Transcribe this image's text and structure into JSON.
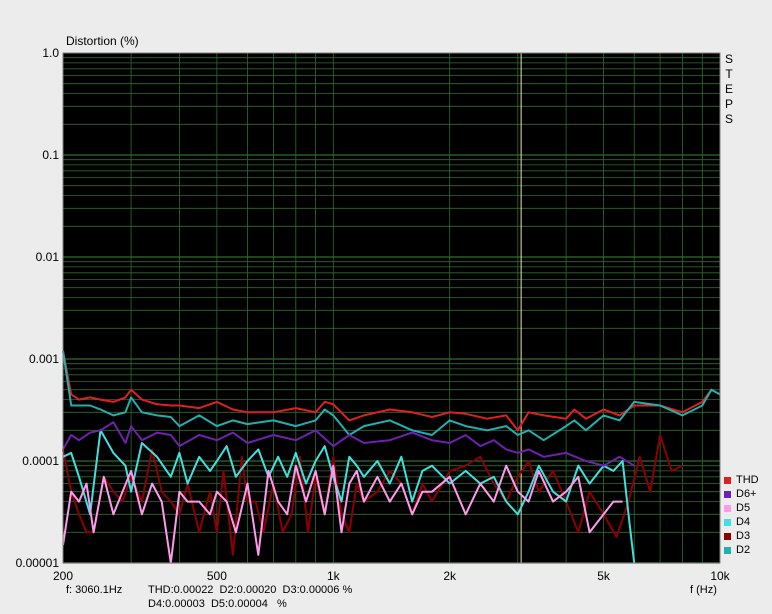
{
  "chart_data": {
    "type": "line",
    "title": "",
    "ylabel": "Distortion (%)",
    "xlabel": "f (Hz)",
    "xscale": "log",
    "yscale": "log",
    "xlim": [
      200,
      10000
    ],
    "ylim": [
      1e-05,
      1.0
    ],
    "grid": true,
    "background": "#000000",
    "grid_color": "#2f6b2f",
    "cursor_color": "#e8e8a0",
    "cursor_x": 3060.1,
    "side_label": [
      "S",
      "T",
      "E",
      "P",
      "S"
    ],
    "yticks": [
      {
        "value": 1.0,
        "label": "1.0"
      },
      {
        "value": 0.1,
        "label": "0.1"
      },
      {
        "value": 0.01,
        "label": "0.01"
      },
      {
        "value": 0.001,
        "label": "0.001"
      },
      {
        "value": 0.0001,
        "label": "0.0001"
      },
      {
        "value": 1e-05,
        "label": "0.00001"
      }
    ],
    "xticks": [
      {
        "value": 200,
        "label": "200"
      },
      {
        "value": 500,
        "label": "500"
      },
      {
        "value": 1000,
        "label": "1k"
      },
      {
        "value": 2000,
        "label": "2k"
      },
      {
        "value": 5000,
        "label": "5k"
      },
      {
        "value": 10000,
        "label": "10k"
      }
    ],
    "series": [
      {
        "name": "THD",
        "color": "#e02020",
        "x": [
          200,
          210,
          220,
          235,
          250,
          270,
          290,
          300,
          320,
          350,
          380,
          400,
          450,
          500,
          550,
          600,
          700,
          800,
          900,
          950,
          1000,
          1100,
          1200,
          1400,
          1600,
          1800,
          2000,
          2200,
          2500,
          2800,
          3000,
          3200,
          3500,
          4000,
          4200,
          4500,
          5000,
          5500,
          6000,
          7000,
          8000,
          9000,
          9500,
          10000
        ],
        "y": [
          0.0012,
          0.00045,
          0.0004,
          0.00042,
          0.0004,
          0.00038,
          0.00042,
          0.0005,
          0.0004,
          0.00036,
          0.00035,
          0.00035,
          0.00033,
          0.00038,
          0.00032,
          0.0003,
          0.0003,
          0.00033,
          0.0003,
          0.00038,
          0.00036,
          0.00025,
          0.00028,
          0.00032,
          0.0003,
          0.00027,
          0.0003,
          0.00029,
          0.00026,
          0.00028,
          0.0002,
          0.0003,
          0.00028,
          0.00026,
          0.00032,
          0.00026,
          0.00032,
          0.00028,
          0.00035,
          0.00035,
          0.0003,
          0.00038,
          0.0005,
          0.00045
        ]
      },
      {
        "name": "D2",
        "color": "#20b0b0",
        "x": [
          200,
          210,
          220,
          235,
          250,
          270,
          290,
          300,
          320,
          350,
          380,
          400,
          450,
          500,
          550,
          600,
          700,
          800,
          900,
          950,
          1000,
          1100,
          1200,
          1400,
          1600,
          1800,
          2000,
          2200,
          2500,
          2800,
          3000,
          3200,
          3500,
          4000,
          4200,
          4500,
          5000,
          5500,
          6000,
          7000,
          8000,
          9000,
          9500,
          10000
        ],
        "y": [
          0.0012,
          0.00035,
          0.00035,
          0.00035,
          0.00032,
          0.00028,
          0.0003,
          0.00042,
          0.0003,
          0.00028,
          0.00027,
          0.00022,
          0.00028,
          0.00022,
          0.00025,
          0.00023,
          0.00025,
          0.00022,
          0.00025,
          0.00032,
          0.00028,
          0.00018,
          0.00022,
          0.00025,
          0.0002,
          0.00018,
          0.00025,
          0.00022,
          0.0002,
          0.00022,
          0.00018,
          0.0002,
          0.00016,
          0.00022,
          0.00025,
          0.0002,
          0.00028,
          0.00025,
          0.00038,
          0.00035,
          0.00028,
          0.00035,
          0.0005,
          0.00045
        ]
      },
      {
        "name": "D3",
        "color": "#8b0000",
        "x": [
          200,
          210,
          220,
          230,
          240,
          255,
          270,
          285,
          300,
          320,
          340,
          360,
          380,
          400,
          420,
          450,
          480,
          500,
          520,
          550,
          580,
          600,
          630,
          660,
          700,
          740,
          780,
          820,
          860,
          900,
          950,
          1000,
          1050,
          1100,
          1150,
          1200,
          1300,
          1400,
          1500,
          1600,
          1700,
          1800,
          2000,
          2200,
          2400,
          2600,
          2800,
          3000,
          3200,
          3400,
          3700,
          4000,
          4300,
          4600,
          5000,
          5400,
          5800,
          6200,
          6600,
          7000,
          7500,
          8000
        ],
        "y": [
          0.00013,
          5e-05,
          3e-05,
          2e-05,
          2e-05,
          7e-05,
          5e-05,
          4e-05,
          7e-05,
          4e-05,
          0.00013,
          5e-05,
          4e-05,
          3e-05,
          6e-05,
          2e-05,
          5e-05,
          2e-05,
          8e-05,
          1.2e-05,
          0.00011,
          4e-05,
          4e-05,
          2e-05,
          6e-05,
          2e-05,
          3e-05,
          0.00011,
          2e-05,
          7e-05,
          3e-05,
          0.00011,
          3e-05,
          2e-05,
          6e-05,
          4e-05,
          5e-05,
          8e-05,
          6e-05,
          3e-05,
          6e-05,
          4e-05,
          8e-05,
          9e-05,
          0.00011,
          6e-05,
          4e-05,
          7e-05,
          0.0001,
          5e-05,
          8e-05,
          4e-05,
          2e-05,
          5e-05,
          3e-05,
          1.8e-05,
          4e-05,
          0.00011,
          5e-05,
          0.00018,
          8e-05,
          9e-05
        ]
      },
      {
        "name": "D4",
        "color": "#40e0e0",
        "x": [
          200,
          210,
          220,
          235,
          250,
          270,
          290,
          300,
          320,
          350,
          380,
          400,
          420,
          450,
          480,
          500,
          530,
          560,
          600,
          640,
          680,
          720,
          760,
          800,
          850,
          900,
          950,
          1000,
          1050,
          1100,
          1150,
          1200,
          1300,
          1400,
          1500,
          1600,
          1700,
          1800,
          2000,
          2200,
          2400,
          2600,
          2800,
          3000,
          3200,
          3400,
          3700,
          4000,
          4300,
          4600,
          5000,
          5300,
          5600,
          5800,
          6000
        ],
        "y": [
          0.00011,
          0.00012,
          7e-05,
          3e-05,
          0.0002,
          0.00012,
          9e-05,
          5e-05,
          0.00015,
          0.00011,
          7e-05,
          0.00012,
          6e-05,
          0.00011,
          8e-05,
          0.0001,
          0.00014,
          7e-05,
          0.0001,
          0.00013,
          7e-05,
          0.00011,
          7e-05,
          0.00012,
          6e-05,
          0.0001,
          0.00014,
          7e-05,
          4e-05,
          0.00011,
          9e-05,
          7e-05,
          0.0001,
          6e-05,
          0.00011,
          4e-05,
          8e-05,
          9e-05,
          6e-05,
          8e-05,
          6e-05,
          7e-05,
          4e-05,
          3e-05,
          5e-05,
          9e-05,
          5e-05,
          4e-05,
          9e-05,
          6e-05,
          9e-05,
          8e-05,
          0.0001,
          3e-05,
          1e-05
        ]
      },
      {
        "name": "D5",
        "color": "#ff99ee",
        "x": [
          200,
          210,
          220,
          230,
          240,
          255,
          270,
          285,
          300,
          320,
          340,
          360,
          380,
          400,
          420,
          450,
          480,
          500,
          530,
          560,
          600,
          640,
          680,
          720,
          760,
          800,
          850,
          900,
          950,
          1000,
          1050,
          1100,
          1150,
          1200,
          1300,
          1400,
          1500,
          1600,
          1700,
          1800,
          2000,
          2200,
          2400,
          2600,
          2800,
          3000,
          3200,
          3400,
          3700,
          4000,
          4300,
          4600,
          5000,
          5300,
          5600
        ],
        "y": [
          1.5e-05,
          5e-05,
          4e-05,
          6e-05,
          2e-05,
          7e-05,
          3e-05,
          5e-05,
          8e-05,
          3e-05,
          6e-05,
          4e-05,
          1e-05,
          5e-05,
          4e-05,
          4e-05,
          3e-05,
          5e-05,
          4e-05,
          2e-05,
          6e-05,
          1.2e-05,
          8e-05,
          4e-05,
          3e-05,
          9e-05,
          4e-05,
          8e-05,
          3e-05,
          9e-05,
          2e-05,
          6e-05,
          8e-05,
          4e-05,
          7e-05,
          4e-05,
          6e-05,
          3e-05,
          5e-05,
          5e-05,
          7e-05,
          3e-05,
          6e-05,
          4e-05,
          9e-05,
          5e-05,
          4e-05,
          8e-05,
          4e-05,
          5e-05,
          7e-05,
          2e-05,
          3e-05,
          4e-05,
          4e-05
        ]
      },
      {
        "name": "D6+",
        "color": "#7020b0",
        "x": [
          200,
          210,
          220,
          235,
          250,
          270,
          290,
          300,
          320,
          350,
          380,
          400,
          450,
          500,
          550,
          600,
          700,
          800,
          900,
          1000,
          1100,
          1200,
          1400,
          1600,
          1800,
          2000,
          2200,
          2400,
          2600,
          2800,
          3000,
          3200,
          3500,
          4000,
          4500,
          5000,
          5500,
          6000
        ],
        "y": [
          0.00013,
          0.00018,
          0.00016,
          0.00019,
          0.0002,
          0.00024,
          0.00015,
          0.00022,
          0.00016,
          0.00019,
          0.00018,
          0.00014,
          0.00018,
          0.00016,
          0.00019,
          0.00015,
          0.00018,
          0.00016,
          0.0002,
          0.00014,
          0.00018,
          0.00015,
          0.00016,
          0.00019,
          0.00016,
          0.00015,
          0.00018,
          0.00014,
          0.00016,
          0.00013,
          0.00012,
          0.00013,
          0.00011,
          0.00012,
          0.0001,
          9e-05,
          0.00011,
          9e-05
        ]
      }
    ]
  },
  "readout": {
    "freq": "f: 3060.1Hz",
    "line1": "THD:0.00022  D2:0.00020  D3:0.00006 %",
    "line2": "D4:0.00003  D5:0.00004   %"
  },
  "legend_order": [
    "THD",
    "D6+",
    "D5",
    "D4",
    "D3",
    "D2"
  ]
}
